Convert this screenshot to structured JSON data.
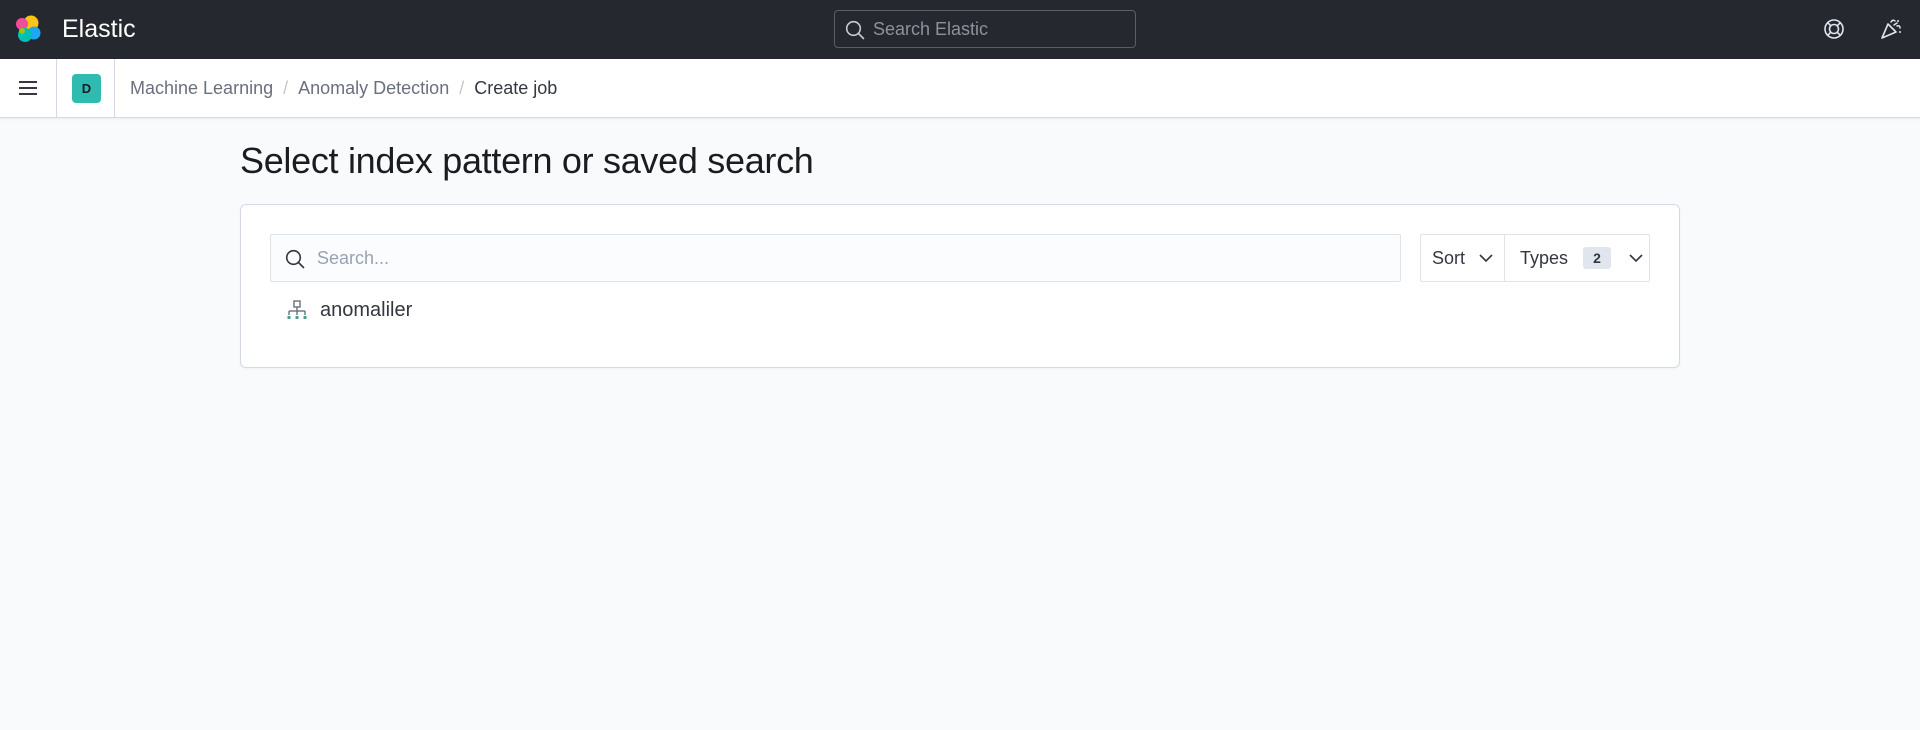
{
  "header": {
    "brand": "Elastic",
    "search_placeholder": "Search Elastic",
    "search_value": ""
  },
  "icons": {
    "logo": "elastic-logo",
    "help": "help-lifebuoy-icon",
    "newsfeed": "newsfeed-party-icon",
    "menu": "hamburger-menu-icon",
    "search": "search-icon",
    "chevron": "chevron-down-icon",
    "index_pattern": "index-pattern-icon"
  },
  "nav": {
    "space_initial": "D",
    "breadcrumbs": [
      {
        "label": "Machine Learning"
      },
      {
        "label": "Anomaly Detection"
      },
      {
        "label": "Create job"
      }
    ],
    "separator": "/"
  },
  "main": {
    "title": "Select index pattern or saved search",
    "search_placeholder": "Search...",
    "search_value": "",
    "sort_label": "Sort",
    "types_label": "Types",
    "types_count": "2",
    "results": [
      {
        "label": "anomaliler",
        "type": "index-pattern"
      }
    ]
  },
  "colors": {
    "header_bg": "#25282f",
    "space_avatar": "#2fbbb0",
    "page_bg": "#f9fafb",
    "index_icon": "#4f9c8f"
  }
}
